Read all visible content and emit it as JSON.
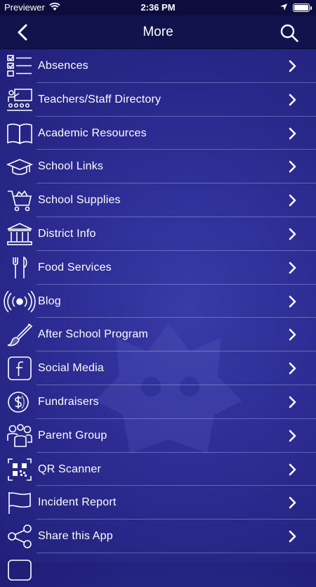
{
  "status_bar": {
    "carrier": "Previewer",
    "time": "2:36 PM"
  },
  "nav": {
    "title": "More",
    "back_icon": "chevron-left-icon",
    "search_icon": "search-icon"
  },
  "menu": [
    {
      "label": "Absences",
      "icon": "checklist-icon"
    },
    {
      "label": "Teachers/Staff Directory",
      "icon": "teacher-icon"
    },
    {
      "label": "Academic Resources",
      "icon": "book-icon"
    },
    {
      "label": "School Links",
      "icon": "graduation-cap-icon"
    },
    {
      "label": "School Supplies",
      "icon": "shopping-cart-icon"
    },
    {
      "label": "District Info",
      "icon": "building-icon"
    },
    {
      "label": "Food Services",
      "icon": "fork-knife-icon"
    },
    {
      "label": "Blog",
      "icon": "broadcast-icon"
    },
    {
      "label": "After School Program",
      "icon": "paintbrush-icon"
    },
    {
      "label": "Social Media",
      "icon": "facebook-icon"
    },
    {
      "label": "Fundraisers",
      "icon": "dollar-coin-icon"
    },
    {
      "label": "Parent Group",
      "icon": "people-group-icon"
    },
    {
      "label": "QR Scanner",
      "icon": "qr-code-icon"
    },
    {
      "label": "Incident Report",
      "icon": "flag-icon"
    },
    {
      "label": "Share this App",
      "icon": "share-icon"
    }
  ],
  "colors": {
    "background": "#2c2c93",
    "nav_bar": "#12124c",
    "status_bar": "#0c0c3e",
    "text": "#ffffff"
  }
}
